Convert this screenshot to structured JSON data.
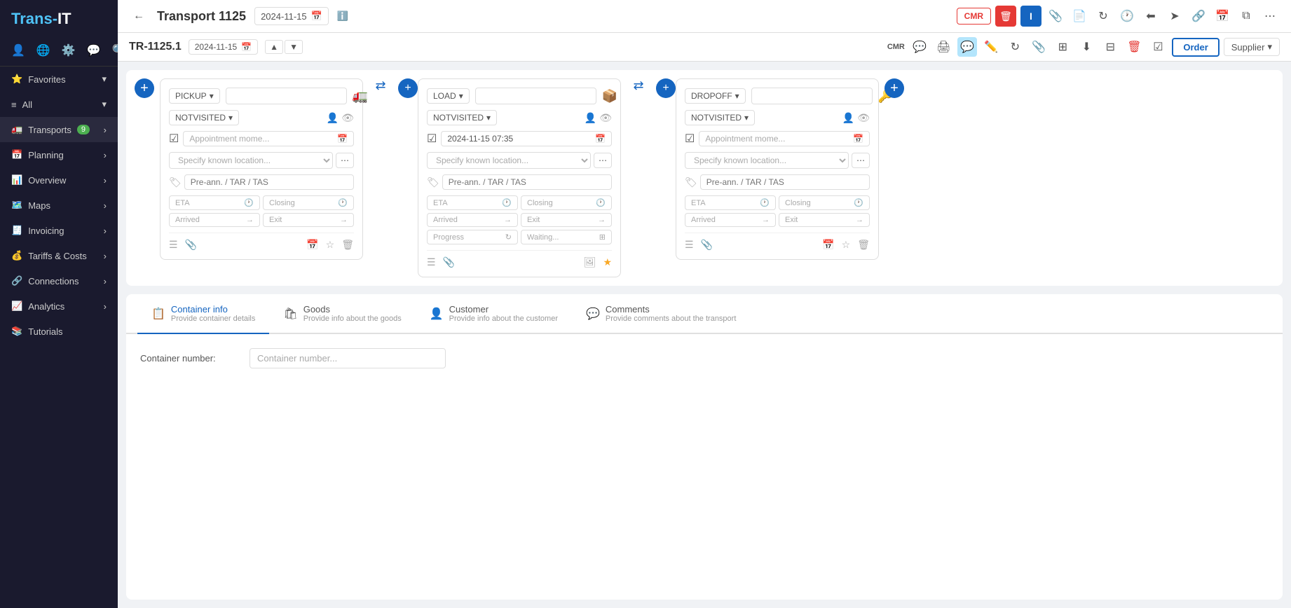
{
  "app": {
    "logo": "Trans-IT"
  },
  "sidebar": {
    "icons": [
      "👤",
      "🌐",
      "⚙️",
      "💬",
      "🔍"
    ],
    "items": [
      {
        "id": "favorites",
        "label": "Favorites",
        "icon": "⭐",
        "expandable": true,
        "star": true
      },
      {
        "id": "all",
        "label": "All",
        "icon": "≡",
        "expandable": true
      },
      {
        "id": "transports",
        "label": "Transports",
        "icon": "🚛",
        "expandable": true,
        "badge": "9"
      },
      {
        "id": "planning",
        "label": "Planning",
        "icon": "📅",
        "expandable": true
      },
      {
        "id": "overview",
        "label": "Overview",
        "icon": "📊",
        "expandable": true
      },
      {
        "id": "maps",
        "label": "Maps",
        "icon": "🗺️",
        "expandable": true
      },
      {
        "id": "invoicing",
        "label": "Invoicing",
        "icon": "🧾",
        "expandable": true
      },
      {
        "id": "tariffs",
        "label": "Tariffs & Costs",
        "icon": "💰",
        "expandable": true
      },
      {
        "id": "connections",
        "label": "Connections",
        "icon": "🔗",
        "expandable": true
      },
      {
        "id": "analytics",
        "label": "Analytics",
        "icon": "📈",
        "expandable": true
      },
      {
        "id": "tutorials",
        "label": "Tutorials",
        "icon": "📚",
        "expandable": false
      }
    ]
  },
  "topbar": {
    "back_label": "←",
    "title": "Transport 1125",
    "date": "2024-11-15",
    "cmr_label": "CMR",
    "actions": {
      "delete": "🗑",
      "user": "I",
      "attach": "📎",
      "doc": "📄",
      "refresh": "↻",
      "clock": "🕐",
      "back_arrow": "⬅",
      "send": "➤",
      "share": "🔗",
      "calendar": "📅",
      "copy": "⧉",
      "more": "⋯"
    }
  },
  "subbar": {
    "ref": "TR-1125.1",
    "date": "2024-11-15",
    "cmr_label": "CMR",
    "nav_up": "▲",
    "nav_down": "▼",
    "order_label": "Order",
    "supplier_label": "Supplier"
  },
  "cards": [
    {
      "id": "pickup",
      "type": "PICKUP",
      "status": "NOTVISITED",
      "appointment": "Appointment mome...",
      "location_placeholder": "Specify known location...",
      "tags_placeholder": "Pre-ann. / TAR / TAS",
      "eta_label": "ETA",
      "closing_label": "Closing",
      "arrived_label": "Arrived",
      "exit_label": "Exit",
      "has_date": false,
      "date_value": ""
    },
    {
      "id": "load",
      "type": "LOAD",
      "status": "NOTVISITED",
      "appointment": "2024-11-15 07:35",
      "location_placeholder": "Specify known location...",
      "tags_placeholder": "Pre-ann. / TAR / TAS",
      "eta_label": "ETA",
      "closing_label": "Closing",
      "arrived_label": "Arrived",
      "exit_label": "Exit",
      "progress_label": "Progress",
      "waiting_label": "Waiting...",
      "has_date": true,
      "date_value": "2024-11-15 07:35",
      "is_starred": true
    },
    {
      "id": "dropoff",
      "type": "DROPOFF",
      "status": "NOTVISITED",
      "appointment": "Appointment mome...",
      "location_placeholder": "Specify known location...",
      "tags_placeholder": "Pre-ann. / TAR / TAS",
      "eta_label": "ETA",
      "closing_label": "Closing",
      "arrived_label": "Arrived",
      "exit_label": "Exit",
      "has_date": false,
      "date_value": ""
    }
  ],
  "bottom": {
    "tabs": [
      {
        "id": "container",
        "icon": "📋",
        "label": "Container info",
        "sublabel": "Provide container details",
        "active": true
      },
      {
        "id": "goods",
        "icon": "🛍",
        "label": "Goods",
        "sublabel": "Provide info about the goods",
        "active": false
      },
      {
        "id": "customer",
        "icon": "👤",
        "label": "Customer",
        "sublabel": "Provide info about the customer",
        "active": false
      },
      {
        "id": "comments",
        "icon": "💬",
        "label": "Comments",
        "sublabel": "Provide comments about the transport",
        "active": false
      }
    ],
    "container_field": {
      "label": "Container number:",
      "placeholder": "Container number..."
    }
  },
  "colors": {
    "primary": "#1565c0",
    "danger": "#e53935",
    "star": "#f9a825",
    "sidebar_bg": "#1a1a2e"
  }
}
